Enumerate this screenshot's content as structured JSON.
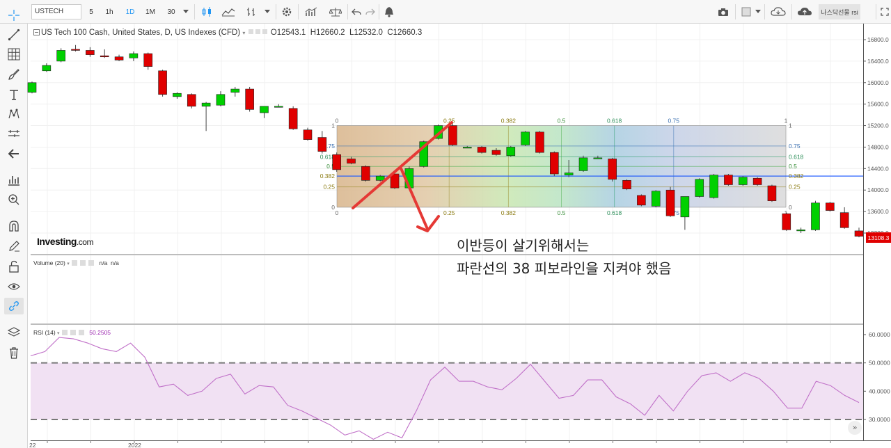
{
  "toolbar": {
    "symbol": "USTECH",
    "intervals": [
      "5",
      "1h",
      "1D",
      "1M",
      "30"
    ],
    "active_interval": "1D",
    "layout_name": "나스닥선물 rsi"
  },
  "legend": {
    "title": "US Tech 100 Cash, United States, D, US Indexes (CFD)",
    "open_label": "O",
    "open": "12543.1",
    "high_label": "H",
    "high": "12660.2",
    "low_label": "L",
    "low": "12532.0",
    "close_label": "C",
    "close": "12660.3"
  },
  "volume": {
    "label": "Volume (20)",
    "value1": "n/a",
    "value2": "n/a"
  },
  "rsi": {
    "label": "RSI (14)",
    "value": "50.2505"
  },
  "price_axis": [
    "16800.0",
    "16400.0",
    "16000.0",
    "15600.0",
    "15200.0",
    "14800.0",
    "14400.0",
    "14000.0",
    "13600.0",
    "13200.0"
  ],
  "rsi_axis": [
    "60.0000",
    "50.0000",
    "40.0000",
    "30.0000"
  ],
  "last_price": "13108.3",
  "time_axis": [
    "22",
    "2022"
  ],
  "fib_top_labels": [
    "0",
    "0.25",
    "0.382",
    "0.5",
    "0.618",
    "0.75",
    "1"
  ],
  "fib_left_labels": [
    "1",
    "0.75",
    "0.618",
    "0.5",
    "0.382",
    "0.25",
    "0"
  ],
  "fib_right_labels": [
    "1",
    "0.75",
    "0.618",
    "0.5",
    "0.382",
    "0.25",
    "0"
  ],
  "fib_bottom_labels": [
    "0",
    "0.25",
    "0.382",
    "0.5",
    "0.618",
    "0.75",
    "1"
  ],
  "annotation": {
    "line1": "이반등이 살기위해서는",
    "line2": "파란선의 38 피보라인을 지켜야 했음"
  },
  "logo": {
    "brand": "Investing",
    "suffix": ".com"
  },
  "colors": {
    "up": "#00d000",
    "down": "#e00000",
    "fib_line": "#2962ff",
    "arrow": "#e53935",
    "rsi_line": "#c070c8",
    "rsi_band": "#f1e1f3"
  },
  "chart_data": [
    {
      "type": "candlestick",
      "title": "US Tech 100 Cash, United States, D, US Indexes (CFD)",
      "ylim": [
        12900,
        17000
      ],
      "candles": [
        {
          "o": 15820,
          "h": 16020,
          "l": 15800,
          "c": 16000
        },
        {
          "o": 16220,
          "h": 16360,
          "l": 16200,
          "c": 16320
        },
        {
          "o": 16400,
          "h": 16640,
          "l": 16380,
          "c": 16600
        },
        {
          "o": 16620,
          "h": 16700,
          "l": 16580,
          "c": 16600
        },
        {
          "o": 16600,
          "h": 16660,
          "l": 16480,
          "c": 16520
        },
        {
          "o": 16500,
          "h": 16620,
          "l": 16460,
          "c": 16480
        },
        {
          "o": 16480,
          "h": 16520,
          "l": 16400,
          "c": 16420
        },
        {
          "o": 16460,
          "h": 16580,
          "l": 16400,
          "c": 16540
        },
        {
          "o": 16540,
          "h": 16560,
          "l": 16240,
          "c": 16300
        },
        {
          "o": 16220,
          "h": 16240,
          "l": 15740,
          "c": 15780
        },
        {
          "o": 15740,
          "h": 15820,
          "l": 15700,
          "c": 15800
        },
        {
          "o": 15780,
          "h": 15800,
          "l": 15520,
          "c": 15560
        },
        {
          "o": 15560,
          "h": 15640,
          "l": 15100,
          "c": 15620
        },
        {
          "o": 15580,
          "h": 15840,
          "l": 15560,
          "c": 15780
        },
        {
          "o": 15820,
          "h": 15920,
          "l": 15740,
          "c": 15880
        },
        {
          "o": 15880,
          "h": 15920,
          "l": 15460,
          "c": 15500
        },
        {
          "o": 15440,
          "h": 15560,
          "l": 15340,
          "c": 15560
        },
        {
          "o": 15560,
          "h": 15600,
          "l": 15540,
          "c": 15560
        },
        {
          "o": 15520,
          "h": 15560,
          "l": 15120,
          "c": 15140
        },
        {
          "o": 15120,
          "h": 15160,
          "l": 14920,
          "c": 14940
        },
        {
          "o": 14980,
          "h": 15100,
          "l": 14680,
          "c": 14720
        },
        {
          "o": 14660,
          "h": 14700,
          "l": 14340,
          "c": 14380
        },
        {
          "o": 14580,
          "h": 14620,
          "l": 14480,
          "c": 14500
        },
        {
          "o": 14440,
          "h": 14460,
          "l": 14160,
          "c": 14180
        },
        {
          "o": 14180,
          "h": 14280,
          "l": 14160,
          "c": 14260
        },
        {
          "o": 14300,
          "h": 14320,
          "l": 14020,
          "c": 14040
        },
        {
          "o": 14040,
          "h": 14440,
          "l": 14000,
          "c": 14400
        },
        {
          "o": 14440,
          "h": 14920,
          "l": 14420,
          "c": 14900
        },
        {
          "o": 14960,
          "h": 15220,
          "l": 14940,
          "c": 15200
        },
        {
          "o": 15200,
          "h": 15240,
          "l": 14820,
          "c": 14840
        },
        {
          "o": 14800,
          "h": 14820,
          "l": 14780,
          "c": 14800
        },
        {
          "o": 14800,
          "h": 14820,
          "l": 14680,
          "c": 14700
        },
        {
          "o": 14740,
          "h": 14780,
          "l": 14640,
          "c": 14660
        },
        {
          "o": 14640,
          "h": 14820,
          "l": 14620,
          "c": 14800
        },
        {
          "o": 14840,
          "h": 15100,
          "l": 14820,
          "c": 15080
        },
        {
          "o": 15080,
          "h": 15100,
          "l": 14680,
          "c": 14700
        },
        {
          "o": 14700,
          "h": 14720,
          "l": 14260,
          "c": 14300
        },
        {
          "o": 14280,
          "h": 14560,
          "l": 14240,
          "c": 14320
        },
        {
          "o": 14360,
          "h": 14640,
          "l": 14340,
          "c": 14600
        },
        {
          "o": 14600,
          "h": 14640,
          "l": 14580,
          "c": 14600
        },
        {
          "o": 14580,
          "h": 14600,
          "l": 14160,
          "c": 14200
        },
        {
          "o": 14180,
          "h": 14200,
          "l": 14000,
          "c": 14020
        },
        {
          "o": 13900,
          "h": 13920,
          "l": 13700,
          "c": 13720
        },
        {
          "o": 13700,
          "h": 14000,
          "l": 13680,
          "c": 13980
        },
        {
          "o": 14000,
          "h": 14060,
          "l": 13500,
          "c": 13520
        },
        {
          "o": 13500,
          "h": 13880,
          "l": 13260,
          "c": 13880
        },
        {
          "o": 13880,
          "h": 14220,
          "l": 13860,
          "c": 14200
        },
        {
          "o": 13860,
          "h": 14300,
          "l": 13840,
          "c": 14280
        },
        {
          "o": 14280,
          "h": 14300,
          "l": 14080,
          "c": 14100
        },
        {
          "o": 14100,
          "h": 14260,
          "l": 14080,
          "c": 14240
        },
        {
          "o": 14220,
          "h": 14240,
          "l": 14080,
          "c": 14100
        },
        {
          "o": 14080,
          "h": 14100,
          "l": 13780,
          "c": 13800
        },
        {
          "o": 13560,
          "h": 13580,
          "l": 13240,
          "c": 13260
        },
        {
          "o": 13260,
          "h": 13300,
          "l": 13200,
          "c": 13260
        },
        {
          "o": 13260,
          "h": 13800,
          "l": 13240,
          "c": 13760
        },
        {
          "o": 13760,
          "h": 13780,
          "l": 13600,
          "c": 13620
        },
        {
          "o": 13580,
          "h": 13680,
          "l": 13280,
          "c": 13300
        },
        {
          "o": 13240,
          "h": 13300,
          "l": 13120,
          "c": 13140
        }
      ],
      "fibonacci": {
        "levels": [
          0,
          0.25,
          0.382,
          0.5,
          0.618,
          0.75,
          1
        ],
        "price_range": [
          13680,
          15200
        ],
        "highlight_level": 0.382
      }
    },
    {
      "type": "line",
      "title": "RSI (14)",
      "ylim": [
        26,
        63
      ],
      "bands": [
        30,
        50
      ],
      "values": [
        52.5,
        54,
        59,
        58.5,
        57,
        55,
        54,
        57,
        52,
        41.5,
        42.5,
        38.5,
        40,
        44.5,
        46,
        39,
        42,
        41.5,
        35,
        33,
        30.5,
        28,
        24.5,
        26,
        23,
        25.5,
        23.5,
        33,
        44,
        48.5,
        43.5,
        43.5,
        41.5,
        40.5,
        44.5,
        49.5,
        43.5,
        37.5,
        38.5,
        44,
        44,
        38,
        35.5,
        31.5,
        38.5,
        33,
        40,
        45.5,
        46.5,
        43.5,
        46.5,
        44.5,
        40,
        34,
        34,
        43.5,
        42,
        38.5,
        36
      ]
    }
  ]
}
